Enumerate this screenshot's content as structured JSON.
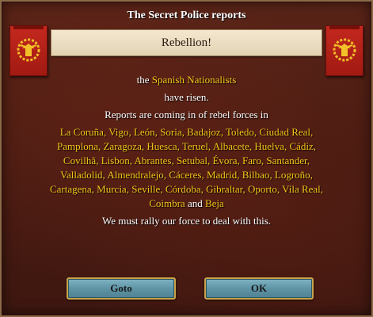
{
  "dialog": {
    "title": "The Secret Police reports",
    "header": "Rebellion!",
    "line1_prefix": "the ",
    "faction": "Spanish Nationalists",
    "line2": "have risen.",
    "line3": "Reports are coming in of rebel forces in",
    "cities": [
      "La Coruña",
      "Vigo",
      "León",
      "Soria",
      "Badajoz",
      "Toledo",
      "Ciudad Real",
      "Pamplona",
      "Zaragoza",
      "Huesca",
      "Teruel",
      "Albacete",
      "Huelva",
      "Cádiz",
      "Covilhã",
      "Lisbon",
      "Abrantes",
      "Setubal",
      "Évora",
      "Faro",
      "Santander",
      "Valladolid",
      "Almendralejo",
      "Cáceres",
      "Madrid",
      "Bilbao",
      "Logroño",
      "Cartagena",
      "Murcia",
      "Seville",
      "Córdoba",
      "Gibraltar",
      "Oporto",
      "Vila Real",
      "Coimbra"
    ],
    "and_word": "and",
    "last_city": "Beja",
    "footer": "We must rally our force to deal with this.",
    "goto_label": "Goto",
    "ok_label": "OK"
  },
  "colors": {
    "highlight": "#f5c518",
    "banner": "#b3221a",
    "button": "#6fa3b3"
  },
  "icons": {
    "left_flag": "eagle-wreath-banner-icon",
    "right_flag": "eagle-wreath-banner-icon"
  }
}
